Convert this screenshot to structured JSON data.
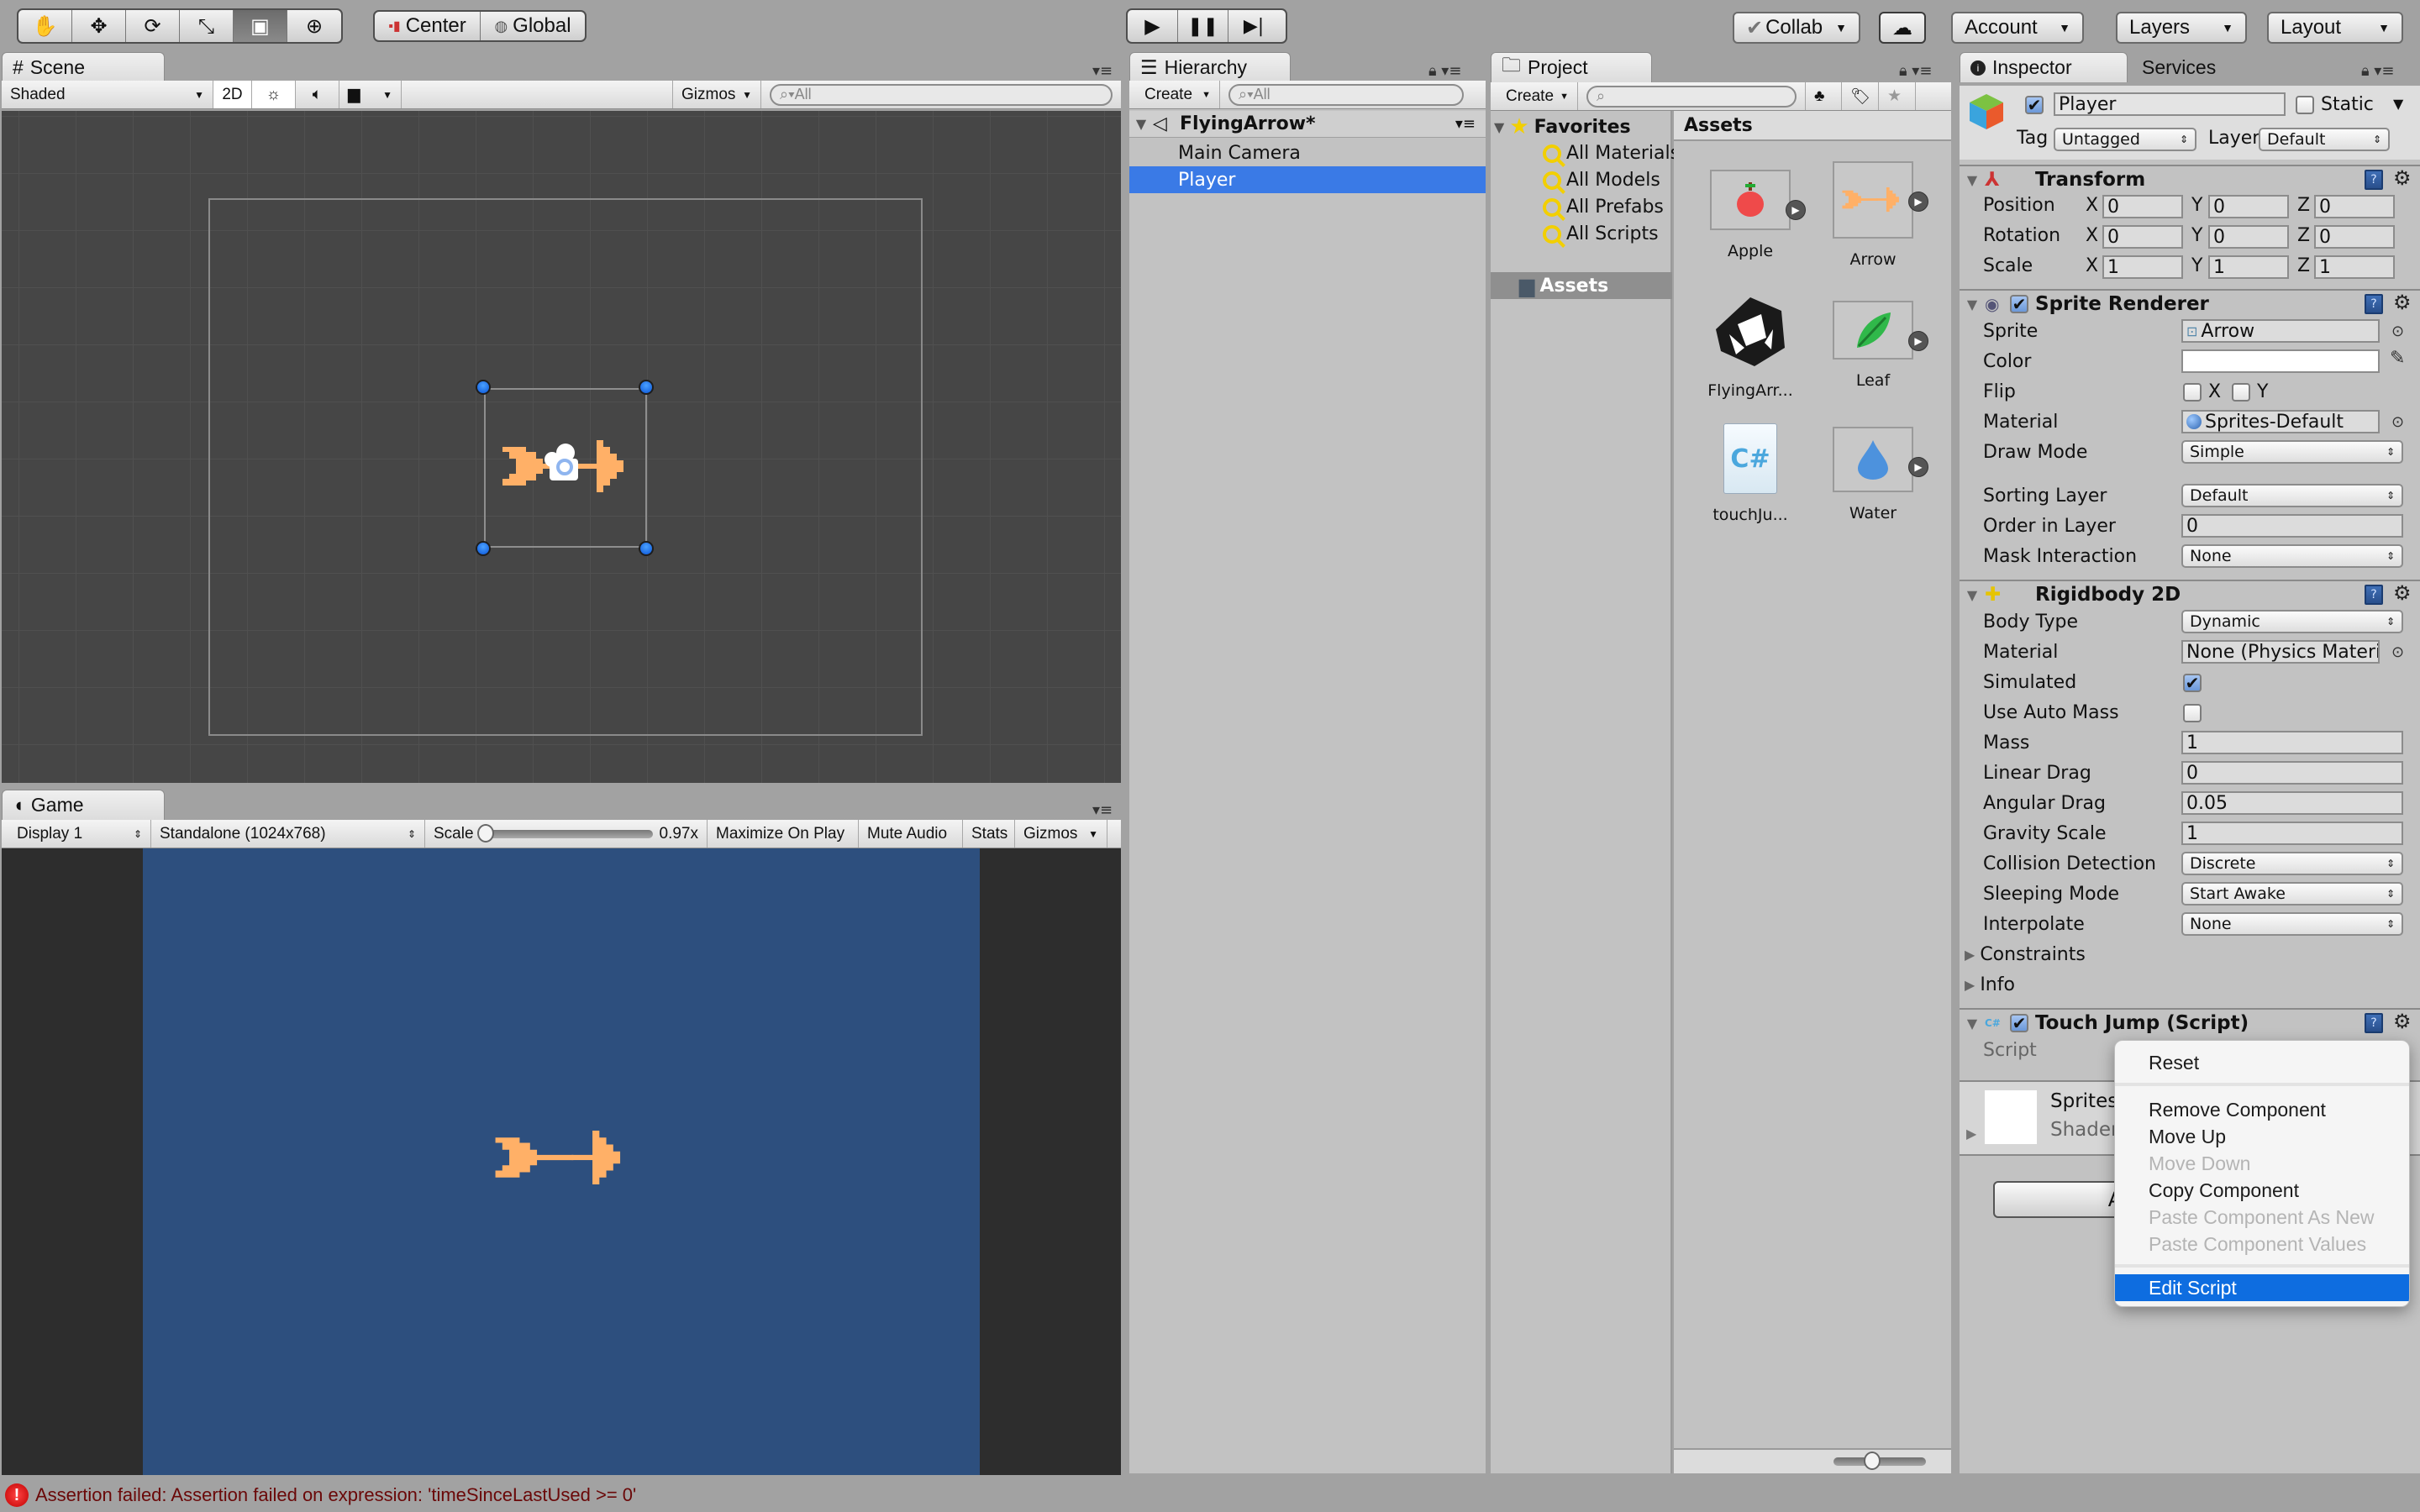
{
  "toolbar": {
    "tools": [
      {
        "name": "hand-tool",
        "glyph": "✋"
      },
      {
        "name": "move-tool",
        "glyph": "✥"
      },
      {
        "name": "rotate-tool",
        "glyph": "⟳"
      },
      {
        "name": "scale-tool",
        "glyph": "⤡"
      },
      {
        "name": "rect-tool",
        "glyph": "▣"
      },
      {
        "name": "transform-tool",
        "glyph": "⊕"
      }
    ],
    "pivot_label": "Center",
    "space_label": "Global",
    "play_glyph": "▶",
    "pause_glyph": "❚❚",
    "step_glyph": "▶|",
    "collab_label": "Collab",
    "cloud_glyph": "☁",
    "account_label": "Account",
    "layers_label": "Layers",
    "layout_label": "Layout"
  },
  "scene": {
    "tab_label": "Scene",
    "shading_mode": "Shaded",
    "mode_2d": "2D",
    "gizmos_label": "Gizmos",
    "search_placeholder": "All"
  },
  "game": {
    "tab_label": "Game",
    "display": "Display 1",
    "resolution": "Standalone (1024x768)",
    "scale_label": "Scale",
    "scale_value": "0.97x",
    "scale_slider_fraction": 0.0,
    "maximize_label": "Maximize On Play",
    "mute_label": "Mute Audio",
    "stats_label": "Stats",
    "gizmos_label": "Gizmos",
    "background_color": "#2d4f7e"
  },
  "hierarchy": {
    "tab_label": "Hierarchy",
    "create_label": "Create",
    "search_placeholder": "All",
    "scene_name": "FlyingArrow*",
    "items": [
      {
        "label": "Main Camera",
        "selected": false
      },
      {
        "label": "Player",
        "selected": true
      }
    ]
  },
  "project": {
    "tab_label": "Project",
    "create_label": "Create",
    "favorites_label": "Favorites",
    "favorites": [
      "All Materials",
      "All Models",
      "All Prefabs",
      "All Scripts"
    ],
    "assets_folder": "Assets",
    "assets_header": "Assets",
    "assets": [
      {
        "label": "Apple",
        "type": "sprite"
      },
      {
        "label": "Arrow",
        "type": "sprite"
      },
      {
        "label": "FlyingArr...",
        "type": "scene"
      },
      {
        "label": "Leaf",
        "type": "sprite"
      },
      {
        "label": "touchJu...",
        "type": "script"
      },
      {
        "label": "Water",
        "type": "sprite"
      }
    ]
  },
  "inspector": {
    "tab_label": "Inspector",
    "services_label": "Services",
    "object_name": "Player",
    "active": true,
    "static_label": "Static",
    "tag_label": "Tag",
    "tag_value": "Untagged",
    "layer_label": "Layer",
    "layer_value": "Default",
    "transform": {
      "title": "Transform",
      "rows": [
        {
          "label": "Position",
          "x": "0",
          "y": "0",
          "z": "0"
        },
        {
          "label": "Rotation",
          "x": "0",
          "y": "0",
          "z": "0"
        },
        {
          "label": "Scale",
          "x": "1",
          "y": "1",
          "z": "1"
        }
      ]
    },
    "sprite_renderer": {
      "title": "Sprite Renderer",
      "sprite_label": "Sprite",
      "sprite_value": "Arrow",
      "color_label": "Color",
      "color_value": "#ffffff",
      "flip_label": "Flip",
      "flip_x": "X",
      "flip_y": "Y",
      "material_label": "Material",
      "material_value": "Sprites-Default",
      "draw_mode_label": "Draw Mode",
      "draw_mode_value": "Simple",
      "sorting_layer_label": "Sorting Layer",
      "sorting_layer_value": "Default",
      "order_label": "Order in Layer",
      "order_value": "0",
      "mask_label": "Mask Interaction",
      "mask_value": "None"
    },
    "rigidbody": {
      "title": "Rigidbody 2D",
      "body_type_label": "Body Type",
      "body_type_value": "Dynamic",
      "material_label": "Material",
      "material_value": "None (Physics Materia",
      "simulated_label": "Simulated",
      "auto_mass_label": "Use Auto Mass",
      "mass_label": "Mass",
      "mass_value": "1",
      "linear_drag_label": "Linear Drag",
      "linear_drag_value": "0",
      "angular_drag_label": "Angular Drag",
      "angular_drag_value": "0.05",
      "gravity_label": "Gravity Scale",
      "gravity_value": "1",
      "collision_label": "Collision Detection",
      "collision_value": "Discrete",
      "sleeping_label": "Sleeping Mode",
      "sleeping_value": "Start Awake",
      "interpolate_label": "Interpolate",
      "interpolate_value": "None",
      "constraints_label": "Constraints",
      "info_label": "Info"
    },
    "script_component": {
      "title": "Touch Jump (Script)",
      "script_label": "Script"
    },
    "material_preview": {
      "name": "Sprites",
      "shader_label": "Shader"
    },
    "add_component_label": "A"
  },
  "context_menu": {
    "items": [
      {
        "label": "Reset",
        "enabled": true
      },
      {
        "label": "Remove Component",
        "enabled": true
      },
      {
        "label": "Move Up",
        "enabled": true
      },
      {
        "label": "Move Down",
        "enabled": false
      },
      {
        "label": "Copy Component",
        "enabled": true
      },
      {
        "label": "Paste Component As New",
        "enabled": false
      },
      {
        "label": "Paste Component Values",
        "enabled": false
      },
      {
        "label": "Edit Script",
        "enabled": true,
        "highlighted": true
      }
    ]
  },
  "status": {
    "message": "Assertion failed: Assertion failed on expression: 'timeSinceLastUsed >= 0'"
  },
  "colors": {
    "selection": "#3a7ae6",
    "menu_highlight": "#0e6de0",
    "arrow_sprite": "#ffb067",
    "error_text": "#6a0808"
  }
}
